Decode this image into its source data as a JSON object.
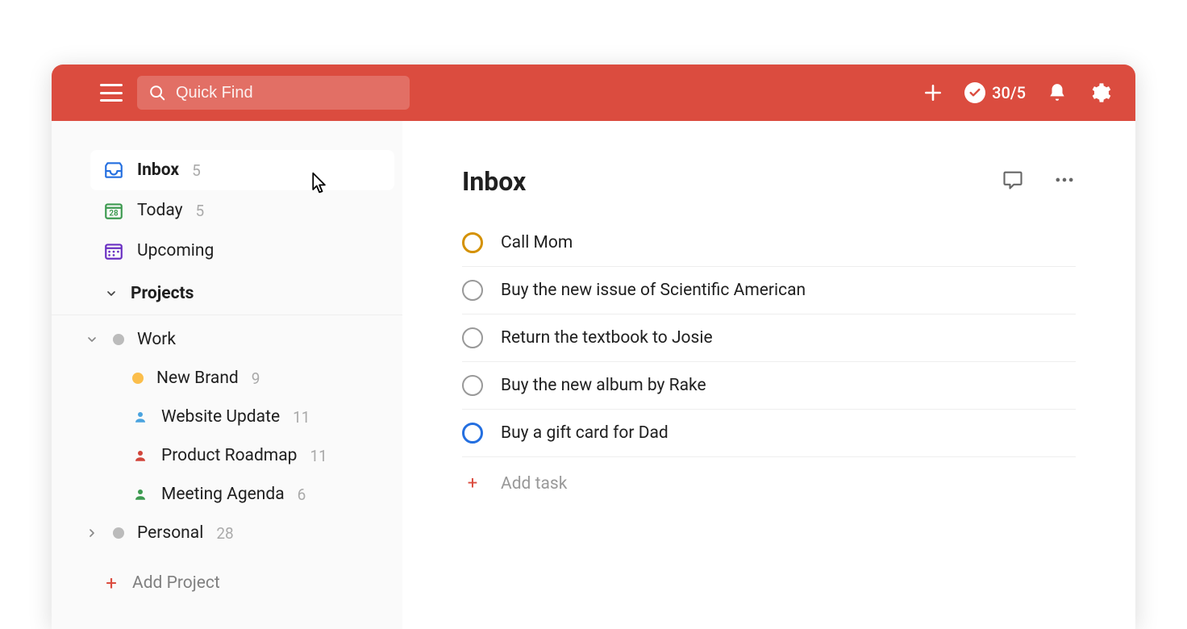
{
  "header": {
    "search_placeholder": "Quick Find",
    "productivity_score": "30/5"
  },
  "sidebar": {
    "nav": [
      {
        "label": "Inbox",
        "count": "5",
        "icon": "inbox",
        "active": true
      },
      {
        "label": "Today",
        "count": "5",
        "icon": "today",
        "active": false
      },
      {
        "label": "Upcoming",
        "count": "",
        "icon": "upcoming",
        "active": false
      }
    ],
    "projects_header": "Projects",
    "projects": [
      {
        "label": "Work",
        "count": "",
        "color": "#bbb",
        "expanded": true,
        "type": "folder",
        "children": [
          {
            "label": "New Brand",
            "count": "9",
            "type": "bullet",
            "color": "#fbbe4b"
          },
          {
            "label": "Website Update",
            "count": "11",
            "type": "person",
            "color": "#4aa3df"
          },
          {
            "label": "Product Roadmap",
            "count": "11",
            "type": "person",
            "color": "#d1453b"
          },
          {
            "label": "Meeting Agenda",
            "count": "6",
            "type": "person",
            "color": "#3d9a50"
          }
        ]
      },
      {
        "label": "Personal",
        "count": "28",
        "color": "#bbb",
        "expanded": false,
        "type": "folder",
        "children": []
      }
    ],
    "add_project_label": "Add Project"
  },
  "main": {
    "title": "Inbox",
    "tasks": [
      {
        "title": "Call Mom",
        "priority_color": "#d49100",
        "ring": true
      },
      {
        "title": "Buy the new issue of Scientific American",
        "priority_color": "#999",
        "ring": false
      },
      {
        "title": "Return the textbook to Josie",
        "priority_color": "#999",
        "ring": false
      },
      {
        "title": "Buy the new album by Rake",
        "priority_color": "#999",
        "ring": false
      },
      {
        "title": "Buy a gift card for Dad",
        "priority_color": "#246fe0",
        "ring": true
      }
    ],
    "add_task_label": "Add task"
  },
  "colors": {
    "accent": "#db4c3f"
  }
}
